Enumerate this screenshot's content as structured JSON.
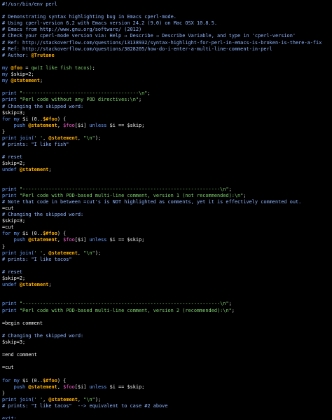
{
  "editor": {
    "lines": [
      [
        {
          "t": "#!/usr/bin/env perl",
          "c": "c"
        }
      ],
      [],
      [
        {
          "t": "# Demonstrating syntax highlighting bug in Emacs cperl-mode.",
          "c": "c"
        }
      ],
      [
        {
          "t": "# Using cperl-version 6.2 with Emacs version 24.2 (9.0) on Mac OSX 10.8.5.",
          "c": "c"
        }
      ],
      [
        {
          "t": "# Emacs from http://www.gnu.org/software/ (2012)",
          "c": "c"
        }
      ],
      [
        {
          "t": "# Check your cperl-mode version via: Help → Describe → Describe Variable, and type in 'cperl-version'",
          "c": "c"
        }
      ],
      [
        {
          "t": "# Ref: http://stackoverflow.com/questions/13138932/syntax-highlight-for-perl-in-emacs-is-broken-is-there-a-fix",
          "c": "c"
        }
      ],
      [
        {
          "t": "# Ref: http://stackoverflow.com/questions/3828205/how-do-i-enter-a-multi-line-comment-in-perl",
          "c": "c"
        }
      ],
      [
        {
          "t": "# Author: ",
          "c": "c"
        },
        {
          "t": "@Trutane",
          "c": "u"
        }
      ],
      [],
      [
        {
          "t": "my ",
          "c": "k"
        },
        {
          "t": "@foo",
          "c": "a"
        },
        {
          "t": " = ",
          "c": "n"
        },
        {
          "t": "qw(I like fish tacos)",
          "c": "s"
        },
        {
          "t": ";",
          "c": "n"
        }
      ],
      [
        {
          "t": "my ",
          "c": "k"
        },
        {
          "t": "$skip",
          "c": "v"
        },
        {
          "t": "=2;",
          "c": "n"
        }
      ],
      [
        {
          "t": "my ",
          "c": "k"
        },
        {
          "t": "@statement",
          "c": "a"
        },
        {
          "t": ";",
          "c": "n"
        }
      ],
      [],
      [
        {
          "t": "print ",
          "c": "k"
        },
        {
          "t": "\"----------------------------------------\\n\"",
          "c": "s"
        },
        {
          "t": ";",
          "c": "n"
        }
      ],
      [
        {
          "t": "print ",
          "c": "k"
        },
        {
          "t": "\"Perl code without any POD directives:\\n\"",
          "c": "s"
        },
        {
          "t": ";",
          "c": "n"
        }
      ],
      [
        {
          "t": "# Changing the skipped word:",
          "c": "c"
        }
      ],
      [
        {
          "t": "$skip=3;",
          "c": "v"
        }
      ],
      [
        {
          "t": "for my ",
          "c": "k"
        },
        {
          "t": "$i",
          "c": "v"
        },
        {
          "t": " (0..",
          "c": "n"
        },
        {
          "t": "$#foo",
          "c": "a"
        },
        {
          "t": ") {",
          "c": "n"
        }
      ],
      [
        {
          "t": "    push ",
          "c": "k"
        },
        {
          "t": "@statement",
          "c": "a"
        },
        {
          "t": ", ",
          "c": "n"
        },
        {
          "t": "$foo",
          "c": "h"
        },
        {
          "t": "[$i] ",
          "c": "n"
        },
        {
          "t": "unless ",
          "c": "k"
        },
        {
          "t": "$i == $skip;",
          "c": "v"
        }
      ],
      [
        {
          "t": "}",
          "c": "n"
        }
      ],
      [
        {
          "t": "print ",
          "c": "k"
        },
        {
          "t": "join(",
          "c": "k"
        },
        {
          "t": "' '",
          "c": "s"
        },
        {
          "t": ", ",
          "c": "n"
        },
        {
          "t": "@statement",
          "c": "a"
        },
        {
          "t": ", ",
          "c": "n"
        },
        {
          "t": "\"\\n\"",
          "c": "s"
        },
        {
          "t": ");",
          "c": "n"
        }
      ],
      [
        {
          "t": "# prints: \"I like fish\"",
          "c": "c"
        }
      ],
      [],
      [
        {
          "t": "# reset",
          "c": "c"
        }
      ],
      [
        {
          "t": "$skip=2;",
          "c": "v"
        }
      ],
      [
        {
          "t": "undef ",
          "c": "k"
        },
        {
          "t": "@statement",
          "c": "a"
        },
        {
          "t": ";",
          "c": "n"
        }
      ],
      [],
      [],
      [
        {
          "t": "print ",
          "c": "k"
        },
        {
          "t": "\"--------------------------------------------------------------------\\n\"",
          "c": "s"
        },
        {
          "t": ";",
          "c": "n"
        }
      ],
      [
        {
          "t": "print ",
          "c": "k"
        },
        {
          "t": "\"Perl code with POD-based multi-line comment, version 1 (not recommended):\\n\"",
          "c": "s"
        },
        {
          "t": ";",
          "c": "n"
        }
      ],
      [
        {
          "t": "# Note that code in between =cut's is NOT highlighted as comments, yet it is effectively commented out.",
          "c": "c"
        }
      ],
      [
        {
          "t": "=cut",
          "c": "p"
        }
      ],
      [
        {
          "t": "# Changing the skipped word:",
          "c": "c"
        }
      ],
      [
        {
          "t": "$skip=3;",
          "c": "v"
        }
      ],
      [
        {
          "t": "=cut",
          "c": "p"
        }
      ],
      [
        {
          "t": "for my ",
          "c": "k"
        },
        {
          "t": "$i",
          "c": "v"
        },
        {
          "t": " (0..",
          "c": "n"
        },
        {
          "t": "$#foo",
          "c": "a"
        },
        {
          "t": ") {",
          "c": "n"
        }
      ],
      [
        {
          "t": "    push ",
          "c": "k"
        },
        {
          "t": "@statement",
          "c": "a"
        },
        {
          "t": ", ",
          "c": "n"
        },
        {
          "t": "$foo",
          "c": "h"
        },
        {
          "t": "[$i] ",
          "c": "n"
        },
        {
          "t": "unless ",
          "c": "k"
        },
        {
          "t": "$i == $skip;",
          "c": "v"
        }
      ],
      [
        {
          "t": "}",
          "c": "n"
        }
      ],
      [
        {
          "t": "print ",
          "c": "k"
        },
        {
          "t": "join(",
          "c": "k"
        },
        {
          "t": "' '",
          "c": "s"
        },
        {
          "t": ", ",
          "c": "n"
        },
        {
          "t": "@statement",
          "c": "a"
        },
        {
          "t": ", ",
          "c": "n"
        },
        {
          "t": "\"\\n\"",
          "c": "s"
        },
        {
          "t": ");",
          "c": "n"
        }
      ],
      [
        {
          "t": "# prints: \"I like tacos\"",
          "c": "c"
        }
      ],
      [],
      [
        {
          "t": "# reset",
          "c": "c"
        }
      ],
      [
        {
          "t": "$skip=2;",
          "c": "v"
        }
      ],
      [
        {
          "t": "undef ",
          "c": "k"
        },
        {
          "t": "@statement",
          "c": "a"
        },
        {
          "t": ";",
          "c": "n"
        }
      ],
      [],
      [],
      [
        {
          "t": "print ",
          "c": "k"
        },
        {
          "t": "\"--------------------------------------------------------------------\\n\"",
          "c": "s"
        },
        {
          "t": ";",
          "c": "n"
        }
      ],
      [
        {
          "t": "print ",
          "c": "k"
        },
        {
          "t": "\"Perl code with POD-based multi-line comment, version 2 (recommended):\\n\"",
          "c": "s"
        },
        {
          "t": ";",
          "c": "n"
        }
      ],
      [],
      [
        {
          "t": "=begin comment",
          "c": "p"
        }
      ],
      [],
      [
        {
          "t": "# Changing the skipped word:",
          "c": "c"
        }
      ],
      [
        {
          "t": "$skip=3;",
          "c": "v"
        }
      ],
      [],
      [
        {
          "t": "=end comment",
          "c": "p"
        }
      ],
      [],
      [
        {
          "t": "=cut",
          "c": "p"
        }
      ],
      [],
      [
        {
          "t": "for my ",
          "c": "k"
        },
        {
          "t": "$i",
          "c": "v"
        },
        {
          "t": " (0..",
          "c": "n"
        },
        {
          "t": "$#foo",
          "c": "a"
        },
        {
          "t": ") {",
          "c": "n"
        }
      ],
      [
        {
          "t": "    push ",
          "c": "k"
        },
        {
          "t": "@statement",
          "c": "a"
        },
        {
          "t": ", ",
          "c": "n"
        },
        {
          "t": "$foo",
          "c": "h"
        },
        {
          "t": "[$i] ",
          "c": "n"
        },
        {
          "t": "unless ",
          "c": "k"
        },
        {
          "t": "$i == $skip;",
          "c": "v"
        }
      ],
      [
        {
          "t": "}",
          "c": "n"
        }
      ],
      [
        {
          "t": "print ",
          "c": "k"
        },
        {
          "t": "join(",
          "c": "k"
        },
        {
          "t": "' '",
          "c": "s"
        },
        {
          "t": ", ",
          "c": "n"
        },
        {
          "t": "@statement",
          "c": "a"
        },
        {
          "t": ", ",
          "c": "n"
        },
        {
          "t": "\"\\n\"",
          "c": "s"
        },
        {
          "t": ");",
          "c": "n"
        }
      ],
      [
        {
          "t": "# prints: \"I like tacos\"  --> equivalent to case #2 above",
          "c": "c"
        }
      ],
      [],
      [
        {
          "t": "exit;",
          "c": "k"
        }
      ]
    ]
  },
  "colors": {
    "background": "#000000",
    "comment": "#8eb4ff",
    "keyword": "#6aa0ff",
    "string": "#7ed36e",
    "array": "#ffb000",
    "hash": "#ff5fd7",
    "text": "#e8e8e8"
  }
}
